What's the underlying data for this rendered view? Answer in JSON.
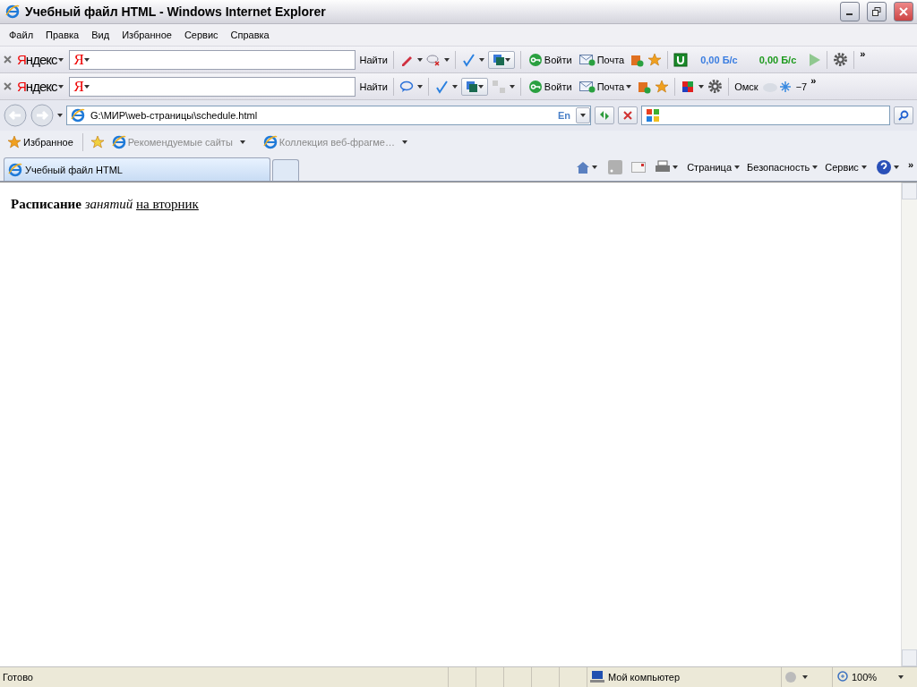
{
  "window": {
    "title": "Учебный файл HTML - Windows Internet Explorer"
  },
  "menu": [
    "Файл",
    "Правка",
    "Вид",
    "Избранное",
    "Сервис",
    "Справка"
  ],
  "yandex_bars": [
    {
      "logo": "Яндекс",
      "field_logo": "Я",
      "search_button": "Найти",
      "login": "Войти",
      "mail": "Почта",
      "speeds": [
        {
          "text": "0,00 Б/с",
          "color": "#3a7de0"
        },
        {
          "text": "0,00 Б/с",
          "color": "#1e9a1e"
        }
      ],
      "more": "»"
    },
    {
      "logo": "Яндекс",
      "field_logo": "Я",
      "search_button": "Найти",
      "login": "Войти",
      "mail": "Почта",
      "city": "Омск",
      "temperature": "−7",
      "more": "»"
    }
  ],
  "address": {
    "value": "G:\\МИР\\web-страницы\\schedule.html",
    "lang": "En"
  },
  "favorites": {
    "label": "Избранное",
    "links": [
      "Рекомендуемые сайты",
      "Коллекция веб-фрагме…"
    ]
  },
  "tabs": [
    {
      "label": "Учебный файл HTML",
      "selected": true
    }
  ],
  "command_bar": {
    "items": [
      "Страница",
      "Безопасность",
      "Сервис"
    ],
    "more": "»"
  },
  "page": {
    "text": "**Расписание** *занятий*",
    "link": "на вторник"
  },
  "status_bar": {
    "status": "Готово",
    "zone": "Мой компьютер",
    "zoom": "100%"
  }
}
